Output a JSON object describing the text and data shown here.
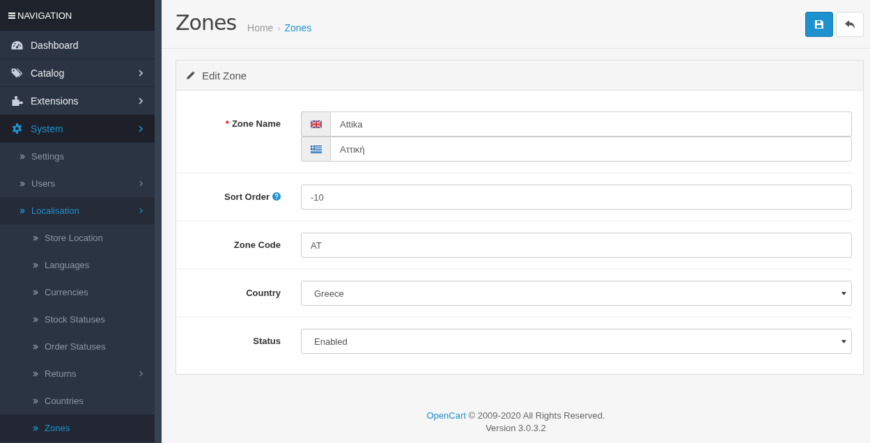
{
  "navigation": {
    "title": "NAVIGATION"
  },
  "menu": [
    {
      "label": "Dashboard",
      "has_submenu": false,
      "selected": false
    },
    {
      "label": "Catalog",
      "has_submenu": true,
      "selected": false
    },
    {
      "label": "Extensions",
      "has_submenu": true,
      "selected": false
    },
    {
      "label": "System",
      "has_submenu": true,
      "selected": true,
      "children": [
        {
          "label": "Settings",
          "has_submenu": false,
          "selected": false
        },
        {
          "label": "Users",
          "has_submenu": true,
          "selected": false
        },
        {
          "label": "Localisation",
          "has_submenu": true,
          "selected": true,
          "children": [
            {
              "label": "Store Location",
              "has_submenu": false,
              "selected": false
            },
            {
              "label": "Languages",
              "has_submenu": false,
              "selected": false
            },
            {
              "label": "Currencies",
              "has_submenu": false,
              "selected": false
            },
            {
              "label": "Stock Statuses",
              "has_submenu": false,
              "selected": false
            },
            {
              "label": "Order Statuses",
              "has_submenu": false,
              "selected": false
            },
            {
              "label": "Returns",
              "has_submenu": true,
              "selected": false
            },
            {
              "label": "Countries",
              "has_submenu": false,
              "selected": false
            },
            {
              "label": "Zones",
              "has_submenu": false,
              "selected": true
            }
          ]
        }
      ]
    }
  ],
  "page": {
    "title": "Zones",
    "breadcrumb": [
      {
        "label": "Home",
        "selected": false
      },
      {
        "label": "Zones",
        "selected": true
      }
    ],
    "separator": "›"
  },
  "panel": {
    "title": "Edit Zone"
  },
  "required_marker": "*",
  "fields": [
    {
      "kind": "multilang",
      "label": "Zone Name",
      "required": true,
      "help": false,
      "values": [
        "Attika",
        "Αττική"
      ]
    },
    {
      "kind": "text",
      "label": "Sort Order",
      "required": false,
      "help": true,
      "value": "-10"
    },
    {
      "kind": "text",
      "label": "Zone Code",
      "required": false,
      "help": false,
      "value": "AT"
    },
    {
      "kind": "select",
      "label": "Country",
      "required": false,
      "help": false,
      "value": "Greece"
    },
    {
      "kind": "select",
      "label": "Status",
      "required": false,
      "help": false,
      "value": "Enabled"
    }
  ],
  "footer": {
    "link": "OpenCart",
    "text": "© 2009-2020 All Rights Reserved.",
    "version": "Version 3.0.3.2"
  }
}
